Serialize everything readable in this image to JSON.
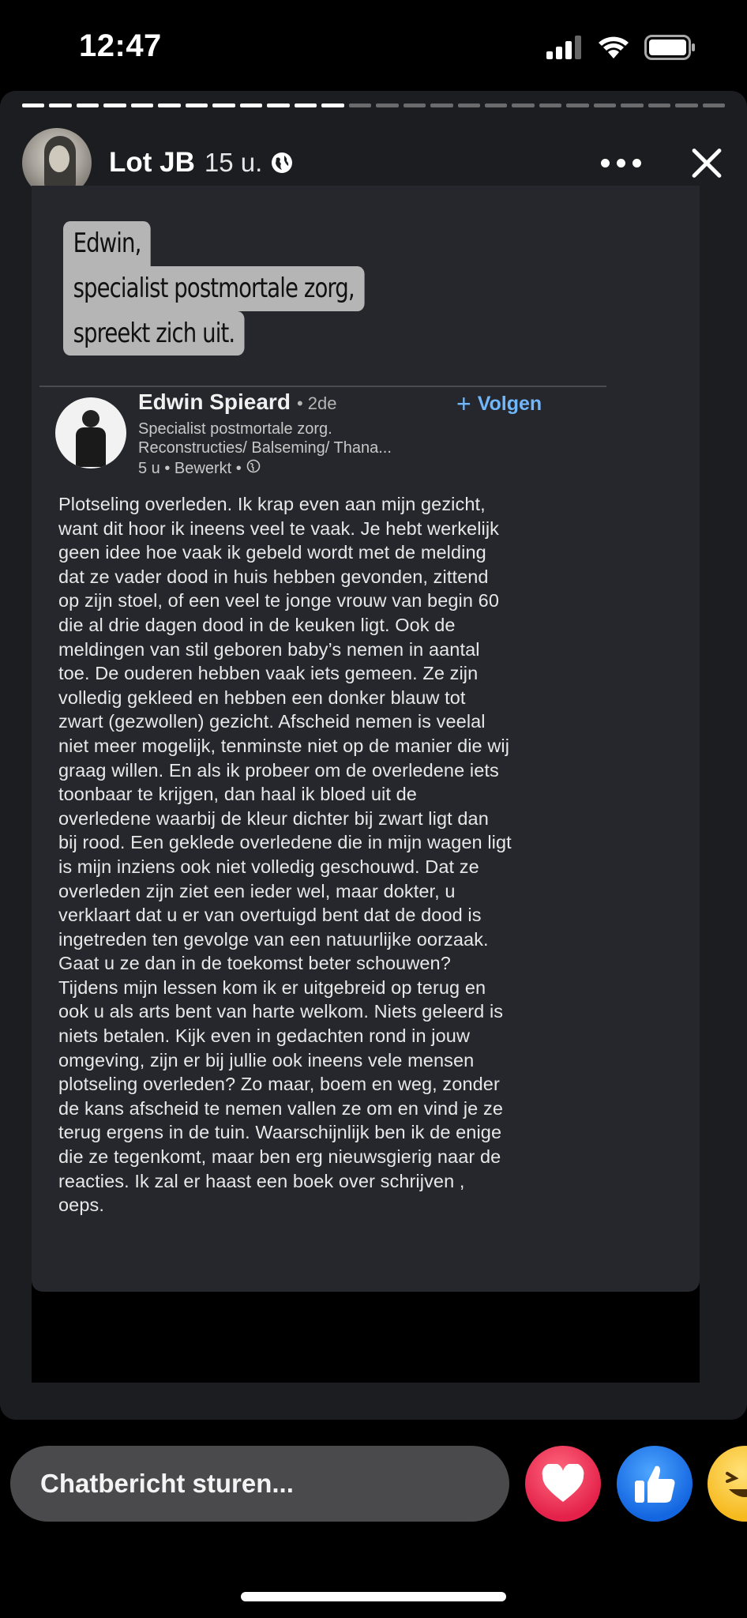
{
  "status_bar": {
    "time": "12:47",
    "icons": [
      "cellular-signal-icon",
      "wifi-icon",
      "battery-icon"
    ]
  },
  "story": {
    "progress": {
      "segments_total": 26,
      "segments_done": 12
    },
    "author_name": "Lot JB",
    "time_ago": "15 u.",
    "privacy_icon": "globe-icon",
    "more_icon": "more-icon",
    "close_icon": "close-icon",
    "caption_lines": [
      "Edwin,",
      "specialist postmortale zorg,",
      "spreekt zich uit."
    ],
    "post": {
      "author_name": "Edwin Spieard",
      "degree": "• 2de",
      "follow_label": "Volgen",
      "headline_line1": "Specialist postmortale zorg.",
      "headline_line2": "Reconstructies/ Balseming/ Thana...",
      "meta": "5 u • Bewerkt •",
      "body": "Plotseling overleden. Ik krap even aan mijn gezicht,\nwant dit hoor ik ineens veel te vaak. Je hebt werkelijk\ngeen idee hoe vaak ik gebeld wordt met de melding\ndat ze vader dood in huis hebben gevonden, zittend\nop zijn stoel, of een veel te jonge vrouw van begin 60\ndie al drie dagen dood in de keuken ligt. Ook de\nmeldingen van stil geboren baby’s nemen in aantal\ntoe. De ouderen hebben vaak iets gemeen. Ze zijn\nvolledig gekleed en hebben een donker blauw tot\nzwart (gezwollen) gezicht. Afscheid nemen is veelal\nniet meer mogelijk, tenminste niet op de manier die wij\ngraag willen. En als ik probeer om de overledene iets\ntoonbaar te krijgen, dan haal ik bloed uit de\noverledene waarbij de kleur dichter bij zwart ligt dan\nbij rood. Een geklede overledene die in mijn wagen ligt\nis mijn inziens ook niet volledig geschouwd. Dat ze\noverleden zijn ziet een ieder wel, maar dokter, u\nverklaart dat u er van overtuigd bent dat de dood is\ningetreden ten gevolge van een natuurlijke oorzaak.\nGaat u ze dan in de toekomst beter schouwen?\nTijdens mijn lessen kom ik er uitgebreid op terug en\nook u als arts bent van harte welkom. Niets geleerd is\nniets betalen. Kijk even in gedachten rond in jouw\nomgeving, zijn er bij jullie ook ineens vele mensen\nplotseling overleden? Zo maar, boem en weg, zonder\nde kans afscheid te nemen vallen ze om en vind je ze\nterug ergens in de tuin. Waarschijnlijk ben ik de enige\ndie ze tegenkomt, maar ben erg nieuwsgierig naar de\nreacties. Ik zal er haast een boek over schrijven ,\noeps."
    }
  },
  "reply": {
    "placeholder": "Chatbericht sturen...",
    "reactions": [
      "heart-icon",
      "like-icon",
      "haha-icon"
    ]
  },
  "colors": {
    "background": "#000000",
    "story_bg": "#1c1d20",
    "post_bg": "#26272c",
    "follow_blue": "#71b7fb",
    "heart_red": "#e4214a",
    "like_blue": "#1466e0",
    "haha_yellow": "#f6b91e"
  }
}
